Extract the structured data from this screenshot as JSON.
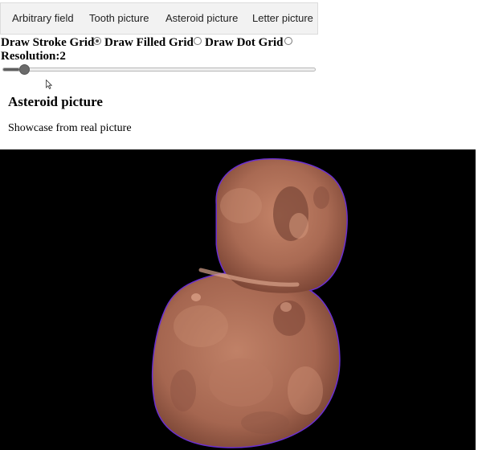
{
  "tabs": [
    {
      "label": "Arbitrary field"
    },
    {
      "label": "Tooth picture"
    },
    {
      "label": "Asteroid picture"
    },
    {
      "label": "Letter picture"
    }
  ],
  "controls": {
    "stroke_grid": {
      "label": "Draw Stroke Grid",
      "checked": true
    },
    "filled_grid": {
      "label": "Draw Filled Grid",
      "checked": false
    },
    "dot_grid": {
      "label": "Draw Dot Grid",
      "checked": false
    }
  },
  "resolution": {
    "label": "Resolution:",
    "value": "2",
    "slider_fraction": 0.05
  },
  "section": {
    "title": "Asteroid picture",
    "description": "Showcase from real picture"
  },
  "canvas": {
    "background": "#000000",
    "object_color": "#b0705a",
    "outline_color": "#6a2fd0"
  }
}
